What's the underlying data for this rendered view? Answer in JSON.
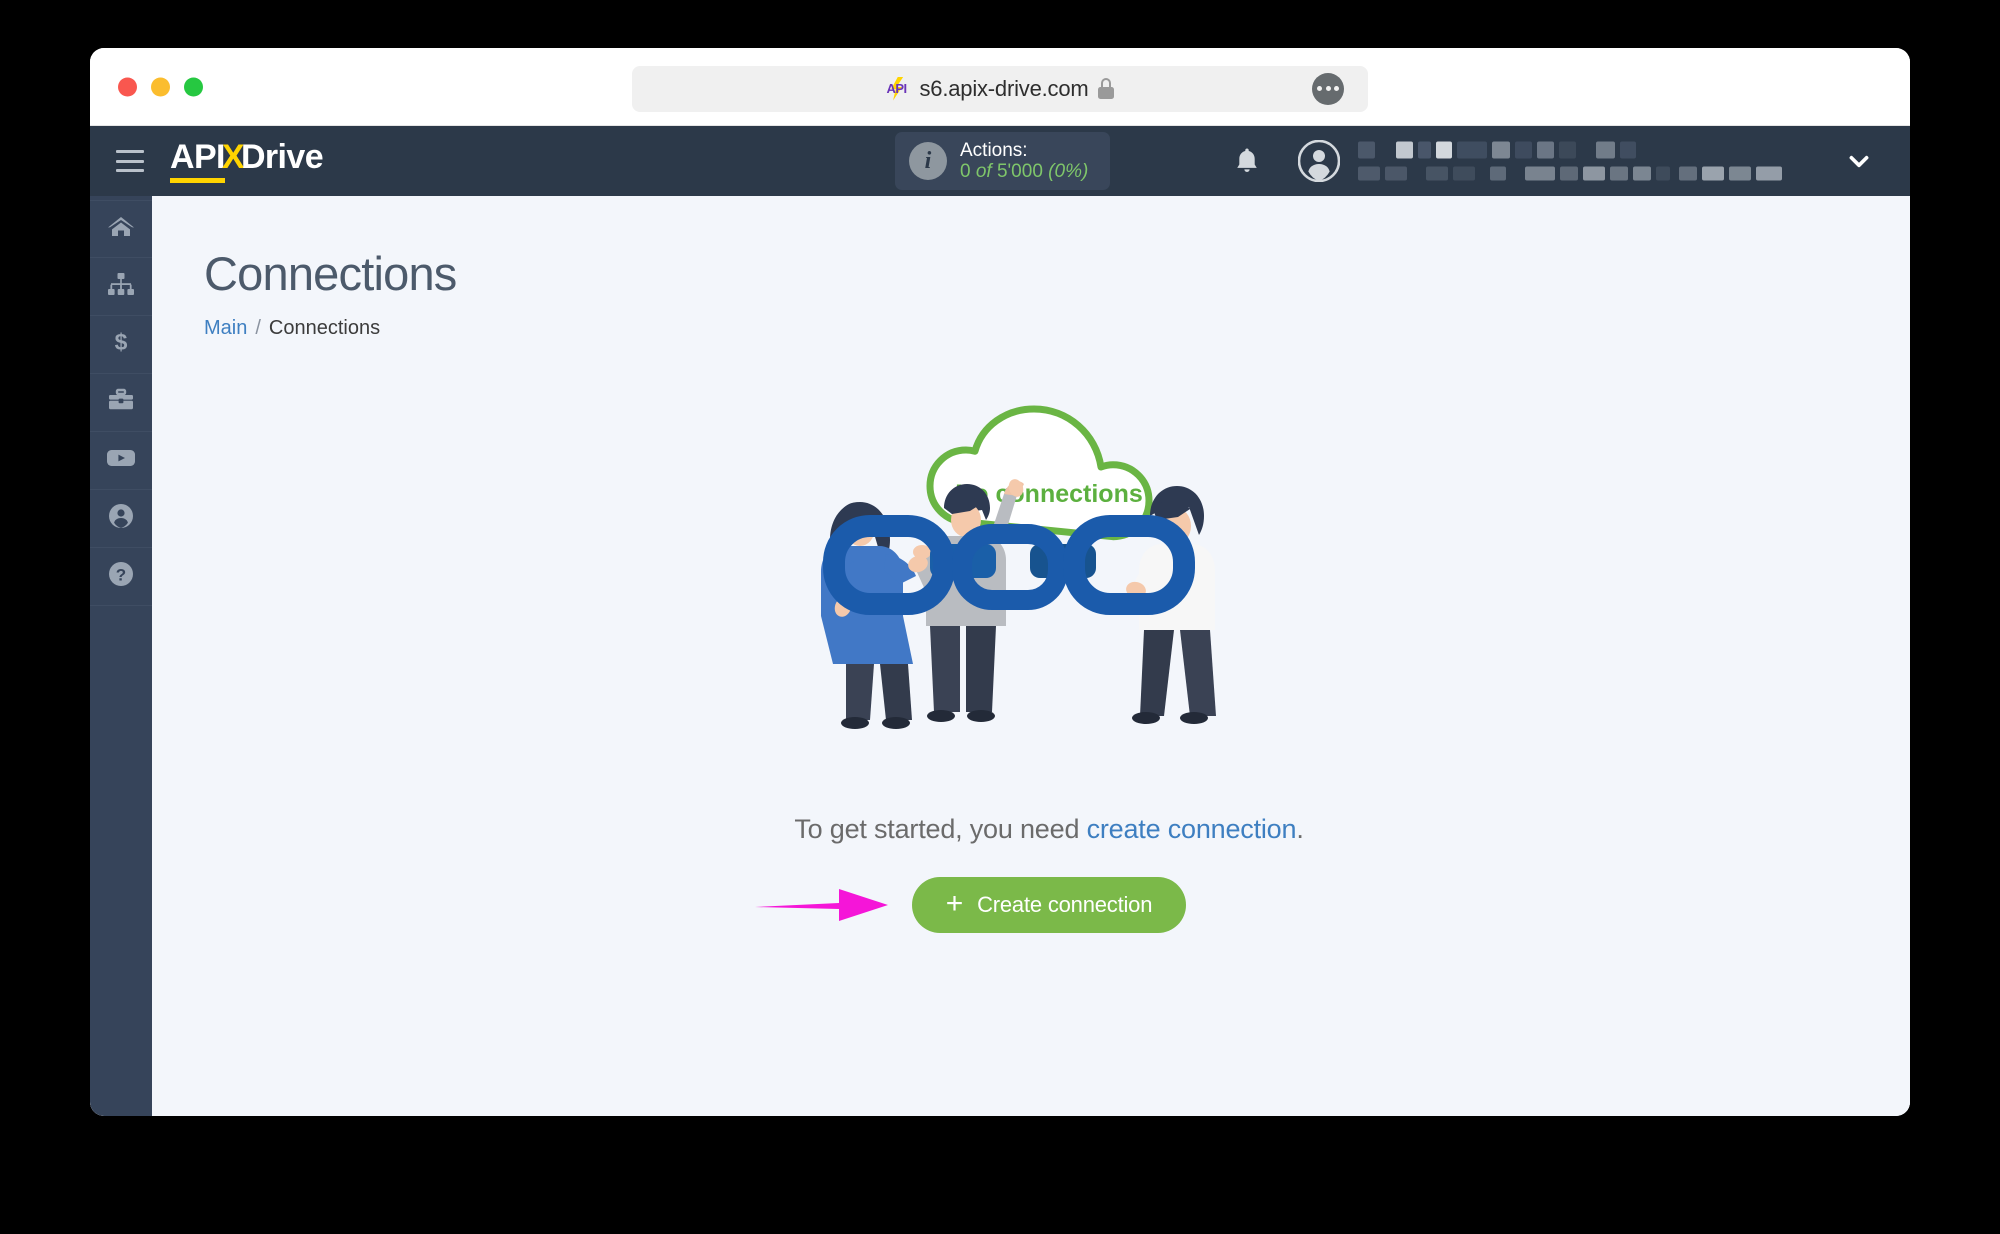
{
  "browser": {
    "url": "s6.apix-drive.com",
    "favicon_label": "API",
    "lock_icon": "lock-icon",
    "menu_icon": "more-options-icon",
    "traffic_lights": [
      "close",
      "minimize",
      "zoom"
    ]
  },
  "header": {
    "menu_icon": "hamburger-icon",
    "brand": {
      "part1": "API",
      "part2": "X",
      "part3": "Drive"
    },
    "actions": {
      "info_icon": "info-icon",
      "label": "Actions:",
      "count": "0",
      "of": " of ",
      "limit": "5'000",
      "percent": "(0%)"
    },
    "bell_icon": "notification-bell-icon",
    "avatar_icon": "user-avatar-icon",
    "user_name_redacted": true,
    "user_email_redacted": true,
    "chevron_icon": "chevron-down-icon"
  },
  "sidebar": {
    "items": [
      {
        "icon": "home-icon",
        "name": "sidebar-item-home"
      },
      {
        "icon": "sitemap-icon",
        "name": "sidebar-item-connections"
      },
      {
        "icon": "dollar-icon",
        "name": "sidebar-item-billing"
      },
      {
        "icon": "briefcase-icon",
        "name": "sidebar-item-services"
      },
      {
        "icon": "youtube-icon",
        "name": "sidebar-item-video"
      },
      {
        "icon": "user-circle-icon",
        "name": "sidebar-item-account"
      },
      {
        "icon": "question-mark-icon",
        "name": "sidebar-item-help"
      }
    ]
  },
  "main": {
    "title": "Connections",
    "breadcrumb": {
      "root": "Main",
      "separator": "/",
      "current": "Connections"
    },
    "empty_state": {
      "cloud_label": "No connections",
      "cta_prefix": "To get started, you need ",
      "cta_link": "create connection",
      "cta_suffix": ".",
      "button_label": "Create connection",
      "button_plus": "+"
    },
    "annotation": {
      "arrow": "pink-arrow-pointing-to-create-connection-button"
    }
  },
  "colors": {
    "header_bg": "#2c3949",
    "sidebar_bg": "#36445a",
    "content_bg": "#f3f6fb",
    "brand_yellow": "#ffd400",
    "link_blue": "#3e7fc1",
    "accent_green": "#7bb949",
    "cloud_green": "#6ab544",
    "arrow_magenta": "#f515d8",
    "chain_blue": "#1b5bab"
  }
}
